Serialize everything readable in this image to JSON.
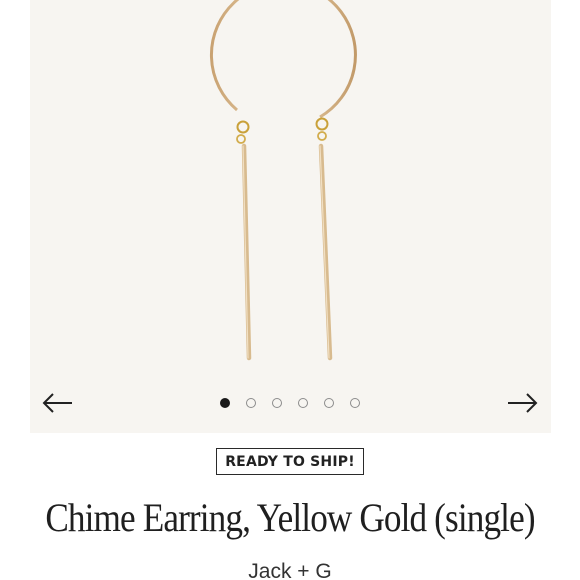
{
  "gallery": {
    "image_alt": "Chime Earring, Yellow Gold",
    "prev_icon": "arrow-left-icon",
    "next_icon": "arrow-right-icon",
    "slide_count": 6,
    "active_slide": 1
  },
  "product": {
    "badge": "READY TO SHIP!",
    "title": "Chime Earring, Yellow Gold (single)",
    "brand": "Jack + G"
  },
  "colors": {
    "photo_background": "#f7f5f1",
    "gold": "#d9b98a",
    "text": "#1f1f1f"
  }
}
